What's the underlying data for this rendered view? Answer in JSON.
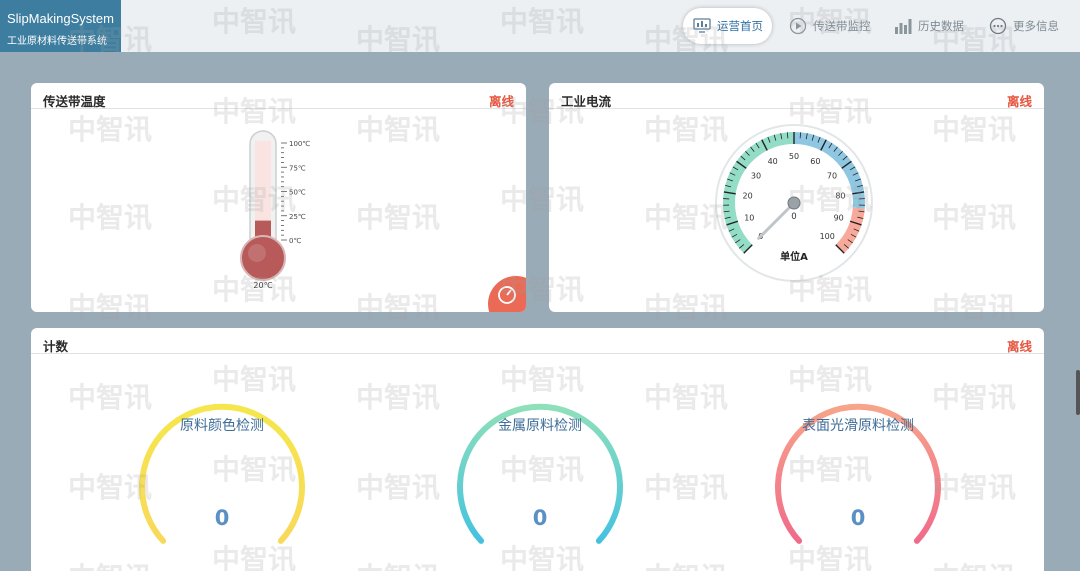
{
  "brand": {
    "title": "SlipMakingSystem",
    "subtitle": "工业原材料传送带系统"
  },
  "nav": [
    {
      "label": "运营首页",
      "icon": "monitor-icon",
      "active": true
    },
    {
      "label": "传送带监控",
      "icon": "play-circle-icon",
      "active": false
    },
    {
      "label": "历史数据",
      "icon": "bar-chart-icon",
      "active": false
    },
    {
      "label": "更多信息",
      "icon": "more-dots-icon",
      "active": false
    }
  ],
  "temperature_panel": {
    "title": "传送带温度",
    "status": "离线",
    "thermometer": {
      "ticks": [
        "100℃",
        "75℃",
        "50℃",
        "25℃",
        "0℃"
      ],
      "value": 20,
      "value_label": "20℃",
      "min": 0,
      "max": 100,
      "color": "#b85a5a"
    }
  },
  "current_panel": {
    "title": "工业电流",
    "status": "离线",
    "gauge": {
      "ticks": [
        "0",
        "10",
        "20",
        "30",
        "40",
        "50",
        "60",
        "70",
        "80",
        "90",
        "100"
      ],
      "unit": "单位A",
      "value": 0,
      "value_label": "0",
      "min": 0,
      "max": 100,
      "bands": [
        {
          "from": 0,
          "to": 50,
          "color": "#93dcc6"
        },
        {
          "from": 50,
          "to": 85,
          "color": "#8fc7e2"
        },
        {
          "from": 85,
          "to": 100,
          "color": "#f7a99b"
        }
      ]
    }
  },
  "count_panel": {
    "title": "计数",
    "status": "离线",
    "gauges": [
      {
        "label": "原料颜色检测",
        "value": "0",
        "color_start": "#f6e64d",
        "color_end": "#f8d95a"
      },
      {
        "label": "金属原料检测",
        "value": "0",
        "color_start": "#8fe0b9",
        "color_end": "#45c2e0"
      },
      {
        "label": "表面光滑原料检测",
        "value": "0",
        "color_start": "#f7a48a",
        "color_end": "#f06b8a"
      }
    ]
  },
  "watermark": "中智讯"
}
